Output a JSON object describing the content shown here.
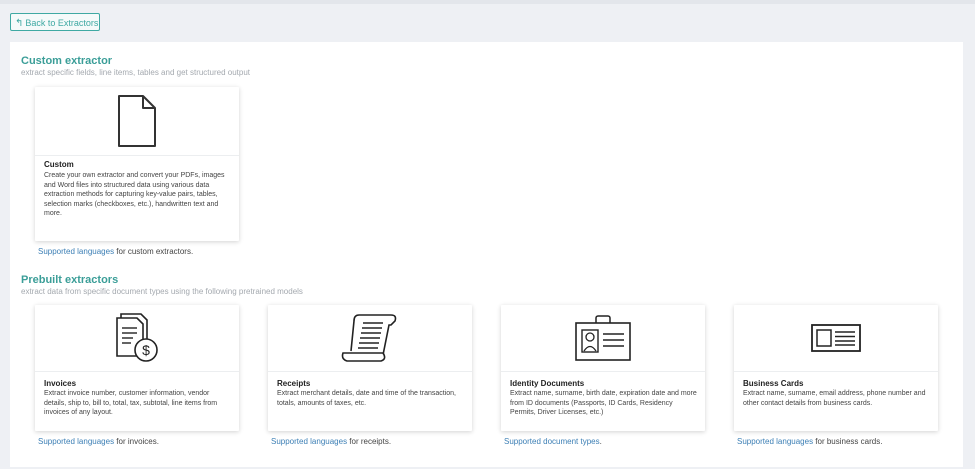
{
  "nav": {
    "back_label": "Back to Extractors"
  },
  "custom": {
    "title": "Custom extractor",
    "subtitle": "extract specific fields, line items, tables and get structured output",
    "card": {
      "title": "Custom",
      "description": "Create your own extractor and convert your PDFs, images and Word files into structured data using various data extraction methods for capturing key-value pairs, tables, selection marks (checkboxes, etc.), handwritten text and more.",
      "icon": "document-icon"
    },
    "support": {
      "link": "Supported languages",
      "suffix": " for custom extractors."
    }
  },
  "prebuilt": {
    "title": "Prebuilt extractors",
    "subtitle": "extract data from specific document types using the following pretrained models",
    "cards": [
      {
        "title": "Invoices",
        "description": "Extract invoice number, customer information, vendor details, ship to, bill to, total, tax, subtotal, line items from invoices of any layout.",
        "icon": "invoice-icon",
        "support_link": "Supported languages",
        "support_suffix": " for invoices."
      },
      {
        "title": "Receipts",
        "description": "Extract merchant details, date and time of the transaction, totals, amounts of taxes, etc.",
        "icon": "receipt-icon",
        "support_link": "Supported languages",
        "support_suffix": " for receipts."
      },
      {
        "title": "Identity Documents",
        "description": "Extract name, surname, birth date, expiration date and more from ID documents (Passports, ID Cards, Residency Permits, Driver Licenses, etc.)",
        "icon": "id-badge-icon",
        "support_link": "Supported document types",
        "support_suffix": "."
      },
      {
        "title": "Business Cards",
        "description": "Extract name, surname, email address, phone number and other contact details from business cards.",
        "icon": "business-card-icon",
        "support_link": "Supported languages",
        "support_suffix": " for business cards."
      }
    ]
  },
  "colors": {
    "accent": "#3b9e98",
    "link": "#3c7fb5"
  }
}
